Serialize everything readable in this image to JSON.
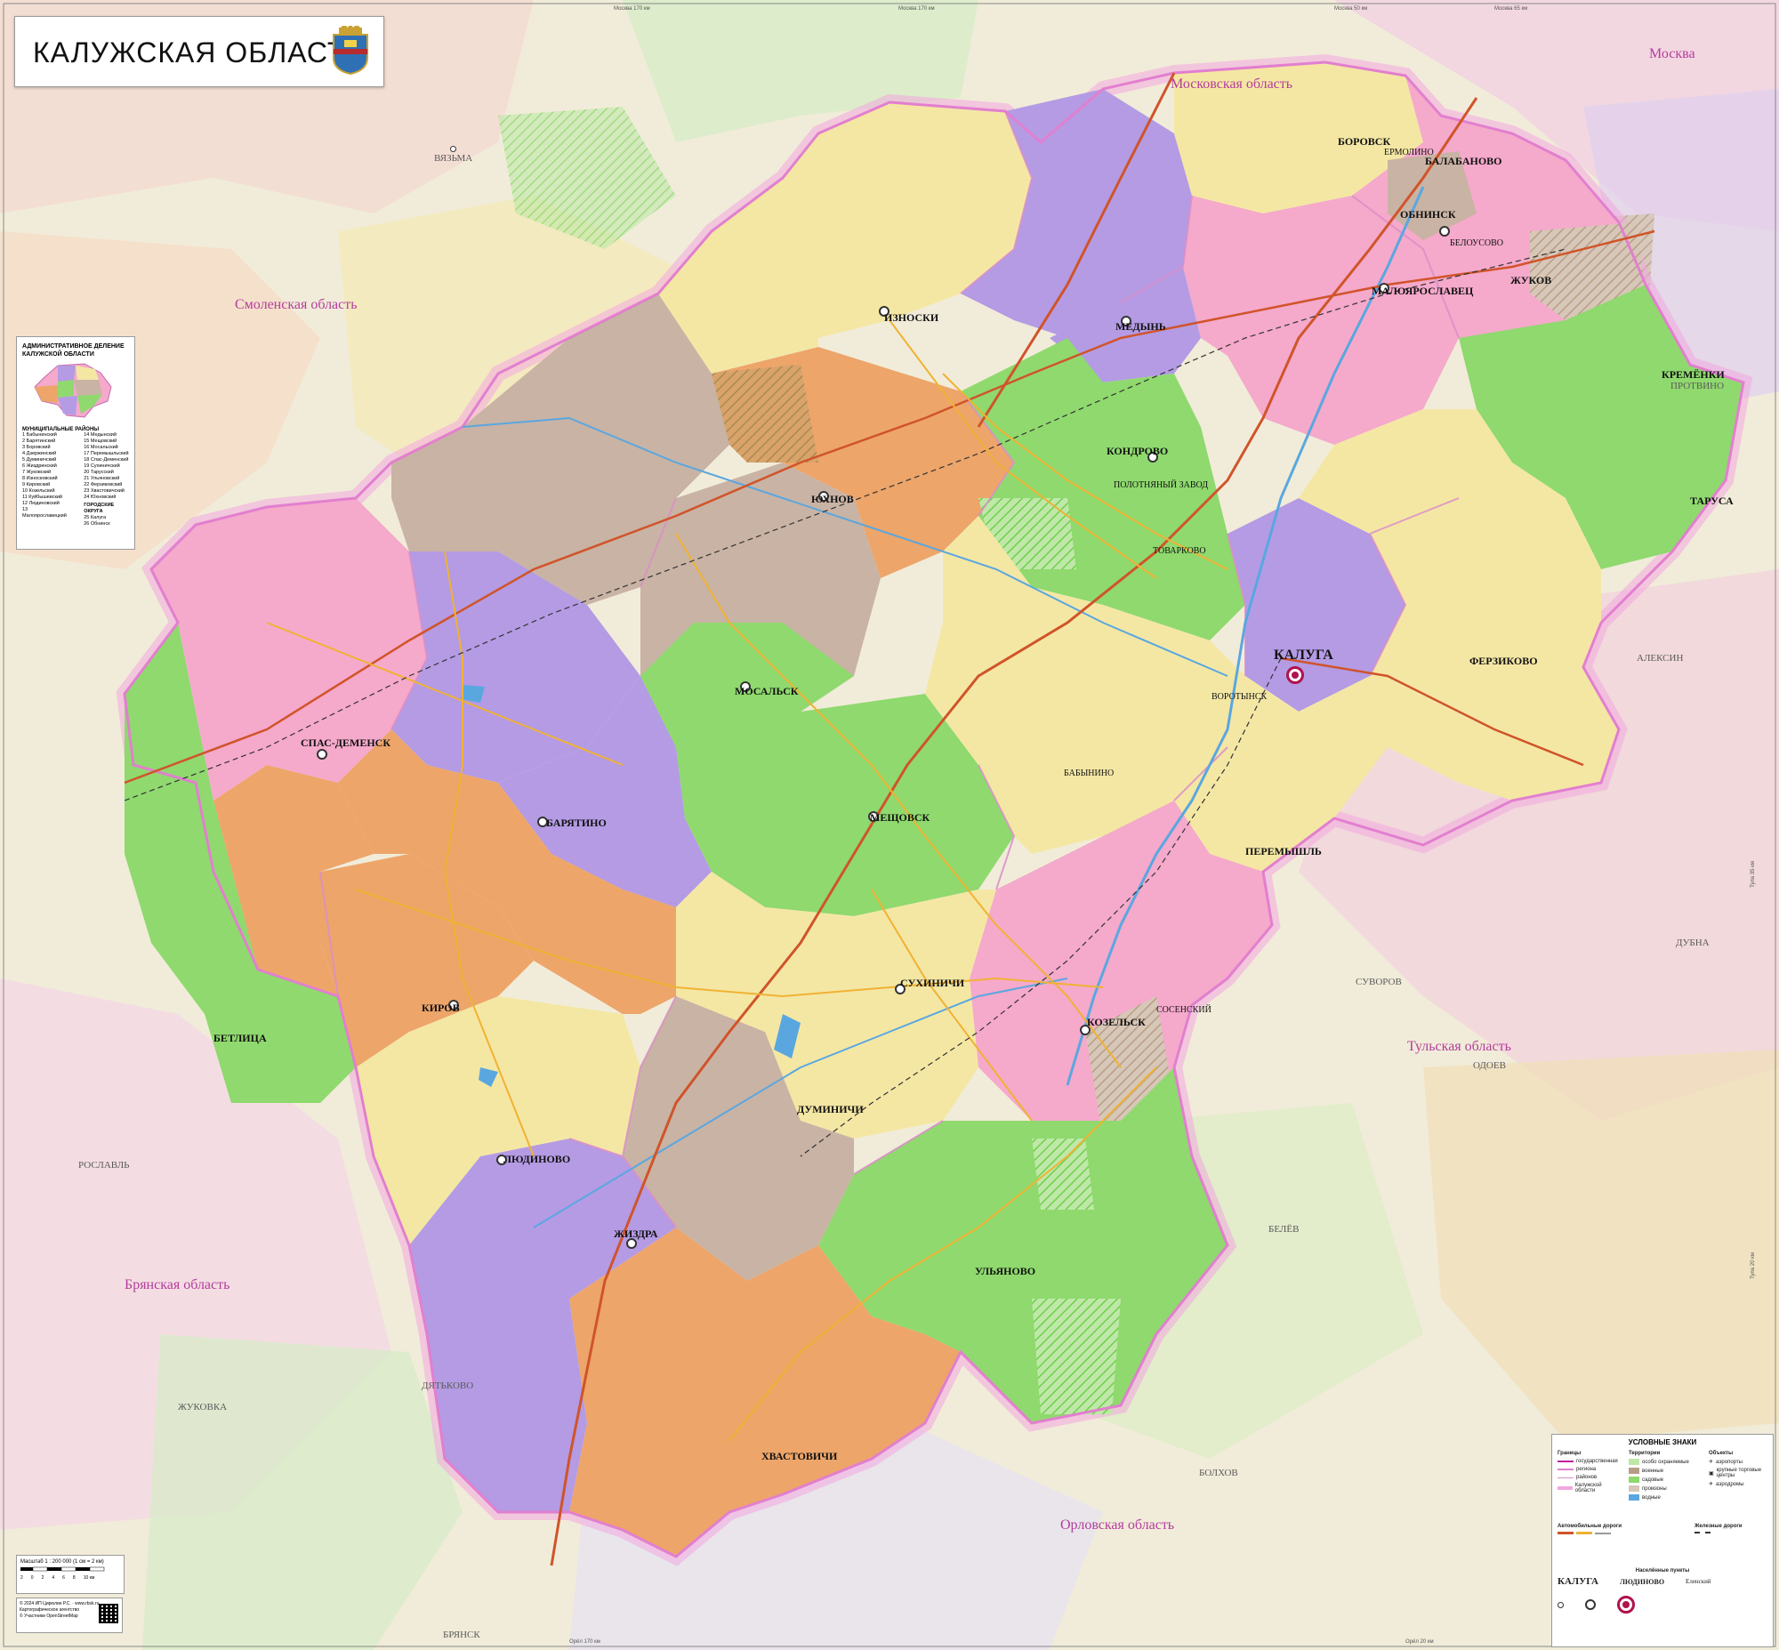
{
  "title": "КАЛУЖСКАЯ ОБЛАСТЬ",
  "icons": {
    "coat_of_arms": "kaluga-coat-of-arms-icon",
    "qr": "qr-code-icon"
  },
  "colors": {
    "region_border": "#e68fd1",
    "pink": "#f5a9cb",
    "purple": "#b49be4",
    "green": "#8fd96e",
    "orange": "#eda56a",
    "yellow": "#f4e7a4",
    "taupe": "#c9b3a4",
    "outside": "#f1ecd9",
    "road_federal": "#d0542a",
    "water": "#5aa7e0"
  },
  "neighbor_regions": {
    "moscow_oblast": "Московская область",
    "moscow": "Москва",
    "smolensk": "Смоленская область",
    "bryansk": "Брянская область",
    "orel": "Орловская область",
    "tula": "Тульская область"
  },
  "cities": {
    "kaluga": "КАЛУГА",
    "obninsk": "ОБНИНСК",
    "maloyaroslavets": "МАЛОЯРОСЛАВЕЦ",
    "borovsk": "БОРОВСК",
    "balabanovo": "БАЛАБАНОВО",
    "ermolino": "ЕРМОЛИНО",
    "belousovo": "БЕЛОУСОВО",
    "zhukov": "ЖУКОВ",
    "kremenki": "КРЕМЁНКИ",
    "tarusa": "ТАРУСА",
    "medyn": "МЕДЫНЬ",
    "kondrovo": "КОНДРОВО",
    "yukhnov": "ЮХНОВ",
    "iznoski": "ИЗНОСКИ",
    "mosalsk": "МОСАЛЬСК",
    "meshchovsk": "МЕЩОВСК",
    "baryatino": "БАРЯТИНО",
    "spas_demensk": "СПАС-ДЕМЕНСК",
    "kirov": "КИРОВ",
    "belyov_pos": "БЕЛЁВ",
    "sukhinichi": "СУХИНИЧИ",
    "kozelsk": "КОЗЕЛЬСК",
    "sosensky": "СОСЕНСКИЙ",
    "peremyshl": "ПЕРЕМЫШЛЬ",
    "babynino": "БАБЫНИНО",
    "ferzikovo": "ФЕРЗИКОВО",
    "vorotynsk": "ВОРОТЫНСК",
    "lyudinovo": "ЛЮДИНОВО",
    "zhizdra": "ЖИЗДРА",
    "duminichi": "ДУМИНИЧИ",
    "ulyanovo": "УЛЬЯНОВО",
    "khvastovichi": "ХВАСТОВИЧИ",
    "betlitsa": "БЕТЛИЦА",
    "tovarkovo": "ТОВАРКОВО",
    "polotnyany_zavod": "ПОЛОТНЯНЫЙ ЗАВОД"
  },
  "outside_cities": {
    "vyazma": "ВЯЗЬМА",
    "aleksin": "АЛЕКСИН",
    "suvorov": "СУВОРОВ",
    "odoev": "ОДОЕВ",
    "belev": "БЕЛЁВ",
    "bolkhov": "БОЛХОВ",
    "bryansk": "БРЯНСК",
    "dyatkovo": "ДЯТЬКОВО",
    "zhukovka": "ЖУКОВКА",
    "dubna": "ДУБНА",
    "roslavl": "РОСЛАВЛЬ",
    "protvino": "ПРОТВИНО"
  },
  "admin_box": {
    "title": "АДМИНИСТРАТИВНОЕ ДЕЛЕНИЕ КАЛУЖСКОЙ ОБЛАСТИ",
    "districts_header": "МУНИЦИПАЛЬНЫЕ РАЙОНЫ",
    "districts_left": [
      "1 Бабынинский",
      "2 Барятинский",
      "3 Боровский",
      "4 Дзержинский",
      "5 Думиничский",
      "6 Жиздринский",
      "7 Жуковский",
      "8 Износковский",
      "9 Кировский",
      "10 Козельский",
      "11 Куйбышевский",
      "12 Людиновский",
      "13 Малоярославецкий"
    ],
    "districts_right": [
      "14 Медынский",
      "15 Мещовский",
      "16 Мосальский",
      "17 Перемышльский",
      "18 Спас-Деменский",
      "19 Сухиничский",
      "20 Тарусский",
      "21 Ульяновский",
      "22 Ферзиковский",
      "23 Хвастовичский",
      "24 Юхновский"
    ],
    "urban_header": "ГОРОДСКИЕ ОКРУГА",
    "urban": [
      "25 Калуга",
      "26 Обнинск"
    ]
  },
  "legend": {
    "title": "УСЛОВНЫЕ ЗНАКИ",
    "borders_header": "Границы",
    "borders": [
      "государственная",
      "региона",
      "районов",
      "Калужской области"
    ],
    "territories_header": "Территории",
    "territories": [
      "особо охраняемые",
      "военные",
      "садовые",
      "промзоны",
      "водные"
    ],
    "objects_header": "Объекты",
    "objects": [
      "аэропорты",
      "крупные торговые центры",
      "аэродромы"
    ],
    "roads_header": "Автомобильные дороги",
    "rail_header": "Железные дороги",
    "places_header": "Населённые пункты",
    "sample_city": "КАЛУГА",
    "sample_town": "ЛЮДИНОВО",
    "sample_village": "Еленский"
  },
  "scale": {
    "text": "Масштаб 1 : 200 000  (1 см = 2 км)",
    "ticks": [
      "2",
      "0",
      "2",
      "4",
      "6",
      "8",
      "10 км"
    ]
  },
  "copyright": {
    "lines": [
      "© 2024 ИП Цирюлин Р.С. · www.rbsk.ru",
      "Картографическое агентство",
      "© Участники OpenStreetMap"
    ]
  },
  "edge_labels": [
    "Москва 170 км",
    "Москва 170 км",
    "Москва 50 км",
    "Москва 65 км",
    "Орёл 170 км",
    "Орёл 20 км",
    "Тула 35 км",
    "Тула 20 км"
  ]
}
